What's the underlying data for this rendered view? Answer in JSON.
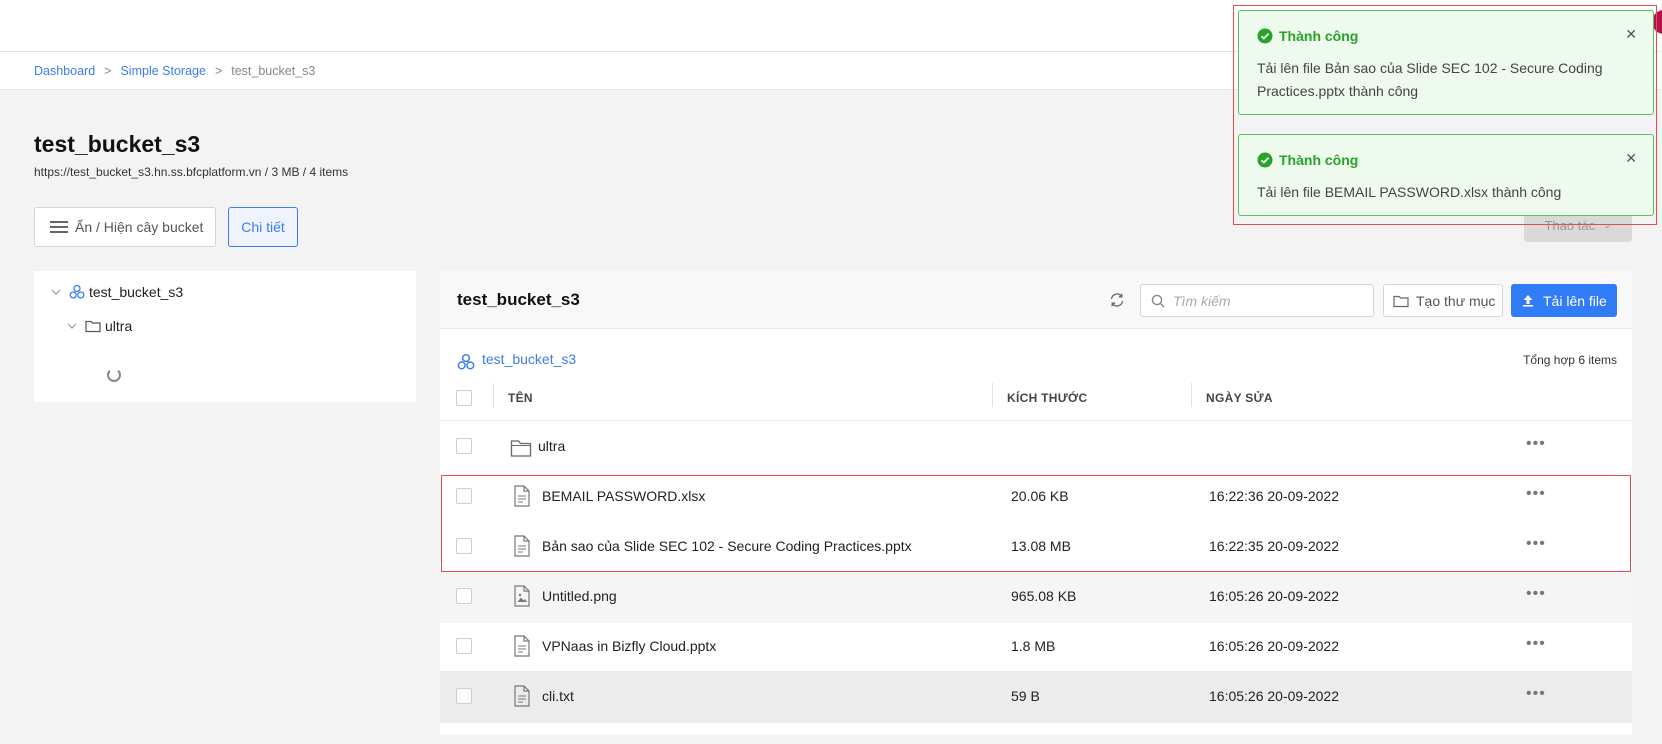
{
  "breadcrumb": [
    "Dashboard",
    "Simple Storage",
    "test_bucket_s3"
  ],
  "page": {
    "title": "test_bucket_s3",
    "subtitle": "https://test_bucket_s3.hn.ss.bfcplatform.vn / 3 MB / 4 items"
  },
  "toolbar": {
    "toggle_tree_label": "Ẩn / Hiện cây bucket",
    "detail_label": "Chi tiết",
    "action_label": "Thao tác"
  },
  "tree": {
    "root": "test_bucket_s3",
    "child": "ultra"
  },
  "main": {
    "title": "test_bucket_s3",
    "search_placeholder": "Tìm kiếm",
    "new_folder_label": "Tạo thư mục",
    "upload_label": "Tải lên file",
    "bucket_link": "test_bucket_s3",
    "total": "Tổng hợp 6 items",
    "columns": [
      "TÊN",
      "KÍCH THƯỚC",
      "NGÀY SỬA"
    ],
    "rows": [
      {
        "type": "folder",
        "name": "ultra",
        "size": "",
        "date": ""
      },
      {
        "type": "file",
        "name": "BEMAIL PASSWORD.xlsx",
        "size": "20.06 KB",
        "date": "16:22:36 20-09-2022"
      },
      {
        "type": "file",
        "name": "Bản sao của Slide SEC 102 - Secure Coding Practices.pptx",
        "size": "13.08 MB",
        "date": "16:22:35 20-09-2022"
      },
      {
        "type": "image",
        "name": "Untitled.png",
        "size": "965.08 KB",
        "date": "16:05:26 20-09-2022"
      },
      {
        "type": "file",
        "name": "VPNaas in Bizfly Cloud.pptx",
        "size": "1.8 MB",
        "date": "16:05:26 20-09-2022"
      },
      {
        "type": "file",
        "name": "cli.txt",
        "size": "59 B",
        "date": "16:05:26 20-09-2022"
      }
    ]
  },
  "toasts": [
    {
      "title": "Thành công",
      "message": "Tải lên file Bản sao của Slide SEC 102 - Secure Coding Practices.pptx thành công"
    },
    {
      "title": "Thành công",
      "message": "Tải lên file BEMAIL PASSWORD.xlsx thành công"
    }
  ],
  "colors": {
    "accent": "#2f7cf6",
    "success": "#27a327",
    "highlight": "#e84b4b"
  }
}
